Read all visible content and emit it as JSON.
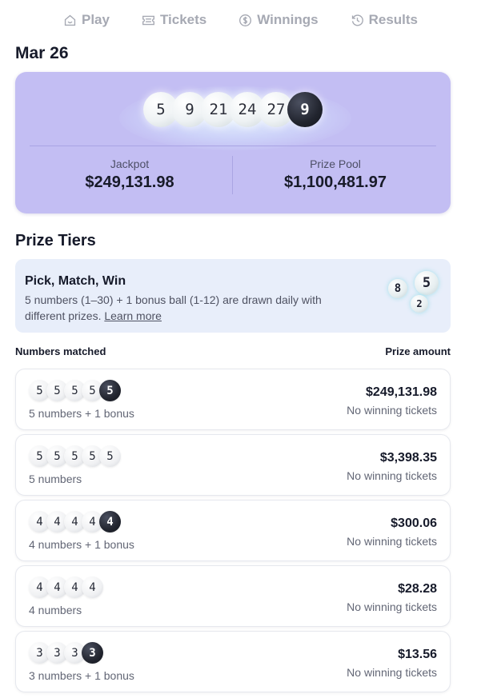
{
  "nav": {
    "items": [
      {
        "label": "Play",
        "icon": "home-icon"
      },
      {
        "label": "Tickets",
        "icon": "ticket-icon"
      },
      {
        "label": "Winnings",
        "icon": "dollar-circle-icon"
      },
      {
        "label": "Results",
        "icon": "history-icon"
      }
    ]
  },
  "draw": {
    "date": "Mar 26",
    "numbers": [
      "5",
      "9",
      "21",
      "24",
      "27"
    ],
    "bonus": "9",
    "jackpot_label": "Jackpot",
    "jackpot_value": "$249,131.98",
    "pool_label": "Prize Pool",
    "pool_value": "$1,100,481.97"
  },
  "prize_tiers": {
    "title": "Prize Tiers",
    "info": {
      "title": "Pick, Match, Win",
      "description": "5 numbers (1–30) + 1 bonus ball (1-12) are drawn daily with different prizes.",
      "learn_more": "Learn more",
      "deco_balls": [
        "8",
        "5",
        "2"
      ]
    },
    "col_matched": "Numbers matched",
    "col_prize": "Prize amount",
    "tiers": [
      {
        "balls": [
          "5",
          "5",
          "5",
          "5"
        ],
        "bonus": "5",
        "desc": "5 numbers + 1 bonus",
        "amount": "$249,131.98",
        "winners": "No winning tickets"
      },
      {
        "balls": [
          "5",
          "5",
          "5",
          "5",
          "5"
        ],
        "bonus": "",
        "desc": "5 numbers",
        "amount": "$3,398.35",
        "winners": "No winning tickets"
      },
      {
        "balls": [
          "4",
          "4",
          "4",
          "4"
        ],
        "bonus": "4",
        "desc": "4 numbers + 1 bonus",
        "amount": "$300.06",
        "winners": "No winning tickets"
      },
      {
        "balls": [
          "4",
          "4",
          "4",
          "4"
        ],
        "bonus": "",
        "desc": "4 numbers",
        "amount": "$28.28",
        "winners": "No winning tickets"
      },
      {
        "balls": [
          "3",
          "3",
          "3"
        ],
        "bonus": "3",
        "desc": "3 numbers + 1 bonus",
        "amount": "$13.56",
        "winners": "No winning tickets"
      }
    ]
  },
  "colors": {
    "draw_card_bg": "#c3bef3",
    "info_card_bg": "#e8eefa",
    "bonus_ball": "#22252f",
    "nav_text": "#a6a9b3"
  }
}
